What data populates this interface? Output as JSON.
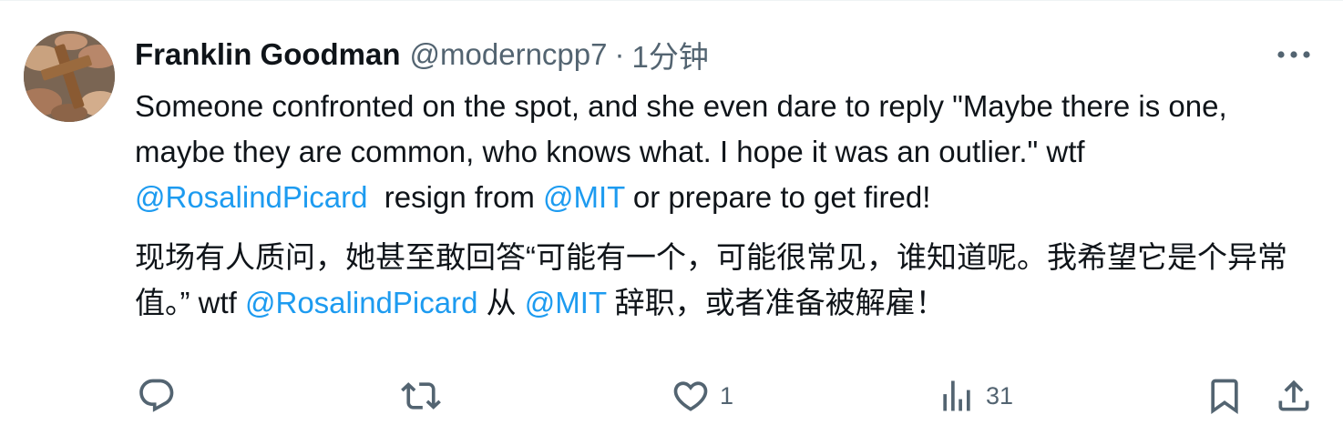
{
  "tweet": {
    "author": {
      "display_name": "Franklin Goodman",
      "handle": "@moderncpp7",
      "avatar": "hands-holding-wooden-cross-avatar"
    },
    "separator": "·",
    "time": "1分钟",
    "paragraphs": [
      {
        "segments": [
          {
            "text": "Someone confronted on the spot, and she even dare to reply \"Maybe there is one, maybe they are common, who knows what. I hope it was an outlier.\" wtf ",
            "mention": false
          },
          {
            "text": "@RosalindPicard",
            "mention": true
          },
          {
            "text": "  resign from ",
            "mention": false
          },
          {
            "text": "@MIT",
            "mention": true
          },
          {
            "text": " or prepare to get fired!",
            "mention": false
          }
        ]
      },
      {
        "segments": [
          {
            "text": "现场有人质问，她甚至敢回答“可能有一个，可能很常见，谁知道呢。我希望它是个异常值。” wtf ",
            "mention": false
          },
          {
            "text": "@RosalindPicard",
            "mention": true
          },
          {
            "text": " 从 ",
            "mention": false
          },
          {
            "text": "@MIT",
            "mention": true
          },
          {
            "text": " 辞职，或者准备被解雇！",
            "mention": false
          }
        ]
      }
    ],
    "actions": {
      "reply": {
        "icon": "reply-icon",
        "count": ""
      },
      "retweet": {
        "icon": "retweet-icon",
        "count": ""
      },
      "like": {
        "icon": "heart-icon",
        "count": "1"
      },
      "views": {
        "icon": "views-bar-chart-icon",
        "count": "31"
      },
      "bookmark": {
        "icon": "bookmark-icon",
        "count": ""
      },
      "share": {
        "icon": "share-icon",
        "count": ""
      }
    },
    "colors": {
      "text": "#0f1419",
      "secondary": "#536471",
      "link": "#1d9bf0",
      "border": "#eff3f4"
    }
  }
}
